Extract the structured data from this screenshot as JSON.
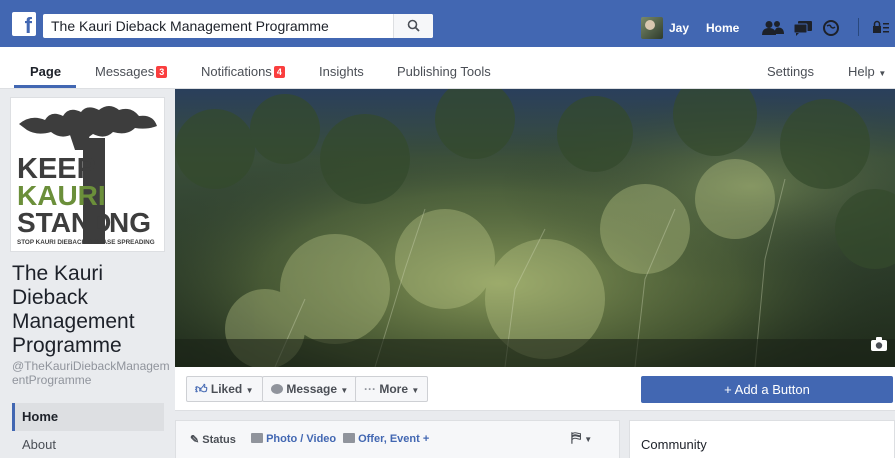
{
  "topbar": {
    "search_value": "The Kauri Dieback Management Programme",
    "user_name": "Jay",
    "home_label": "Home"
  },
  "nav": {
    "tabs": [
      {
        "label": "Page",
        "active": true
      },
      {
        "label": "Messages",
        "badge": "3"
      },
      {
        "label": "Notifications",
        "badge": "4"
      },
      {
        "label": "Insights"
      },
      {
        "label": "Publishing Tools"
      }
    ],
    "settings_label": "Settings",
    "help_label": "Help"
  },
  "page": {
    "name": "The Kauri Dieback Management Programme",
    "handle": "@TheKauriDiebackManagementProgramme",
    "logo": {
      "line1": "KEEP",
      "line2": "KAURI",
      "line3a": "STAND",
      "line3b": "NG",
      "tagline": "STOP KAURI DIEBACK DISEASE SPREADING"
    }
  },
  "side_nav": {
    "items": [
      {
        "label": "Home",
        "active": true
      },
      {
        "label": "About"
      }
    ]
  },
  "actions": {
    "liked": "Liked",
    "message": "Message",
    "more": "More",
    "add_button": "+ Add a Button"
  },
  "composer": {
    "status": "Status",
    "photo_video": "Photo / Video",
    "offer_event": "Offer, Event +"
  },
  "community": {
    "title": "Community"
  },
  "colors": {
    "brand_blue": "#4267b2",
    "badge_red": "#fa3e3e",
    "logo_dark": "#3d3d3d",
    "logo_green": "#6b8f3a"
  }
}
